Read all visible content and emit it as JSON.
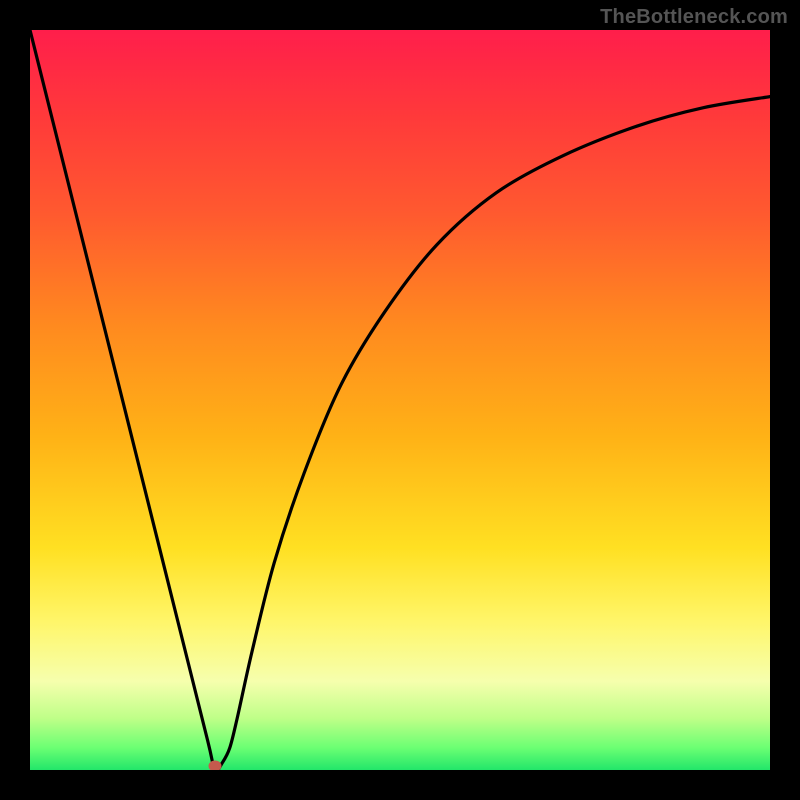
{
  "watermark": "TheBottleneck.com",
  "chart_data": {
    "type": "line",
    "title": "",
    "xlabel": "",
    "ylabel": "",
    "xlim": [
      0,
      100
    ],
    "ylim": [
      0,
      100
    ],
    "series": [
      {
        "name": "curve",
        "x": [
          0,
          5,
          10,
          15,
          20,
          24,
          25,
          26,
          27,
          28,
          30,
          33,
          37,
          42,
          48,
          55,
          63,
          72,
          82,
          91,
          100
        ],
        "y": [
          100,
          80,
          60,
          40,
          20,
          4,
          0,
          1,
          3,
          7,
          16,
          28,
          40,
          52,
          62,
          71,
          78,
          83,
          87,
          89.5,
          91
        ]
      }
    ],
    "marker": {
      "x": 25,
      "y": 0
    },
    "gradient_stops": [
      {
        "pos": 0,
        "color": "#ff1e4b"
      },
      {
        "pos": 12,
        "color": "#ff3a3a"
      },
      {
        "pos": 25,
        "color": "#ff5a2f"
      },
      {
        "pos": 40,
        "color": "#ff8a1f"
      },
      {
        "pos": 55,
        "color": "#ffb216"
      },
      {
        "pos": 70,
        "color": "#ffe022"
      },
      {
        "pos": 80,
        "color": "#fff66a"
      },
      {
        "pos": 88,
        "color": "#f6ffad"
      },
      {
        "pos": 93,
        "color": "#bfff88"
      },
      {
        "pos": 97,
        "color": "#6bff73"
      },
      {
        "pos": 100,
        "color": "#22e66a"
      }
    ]
  }
}
